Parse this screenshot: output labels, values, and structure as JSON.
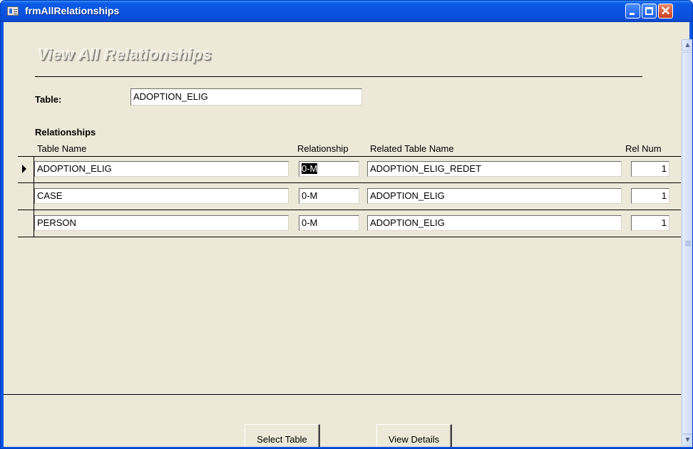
{
  "window": {
    "title": "frmAllRelationships"
  },
  "form": {
    "title": "View All Relationships",
    "table_label": "Table:",
    "table_value": "ADOPTION_ELIG",
    "section_label": "Relationships"
  },
  "grid": {
    "columns": {
      "table_name": "Table Name",
      "relationship": "Relationship",
      "related_table": "Related Table Name",
      "rel_num": "Rel Num"
    },
    "rows": [
      {
        "table_name": "ADOPTION_ELIG",
        "relationship": "0-M",
        "related_table": "ADOPTION_ELIG_REDET",
        "rel_num": "1"
      },
      {
        "table_name": "CASE",
        "relationship": "0-M",
        "related_table": "ADOPTION_ELIG",
        "rel_num": "1"
      },
      {
        "table_name": "PERSON",
        "relationship": "0-M",
        "related_table": "ADOPTION_ELIG",
        "rel_num": "1"
      }
    ]
  },
  "buttons": {
    "select_table": "Select Table",
    "view_details": "View Details"
  },
  "icons": {
    "app": "form-icon",
    "record_selector": "current-record-arrow-icon",
    "scroll_up": "scroll-up-arrow-icon",
    "scroll_down": "scroll-down-arrow-icon"
  },
  "colors": {
    "titlebar": "#0a54e3",
    "form_background": "#ece9d8",
    "close_button": "#c9401f"
  }
}
